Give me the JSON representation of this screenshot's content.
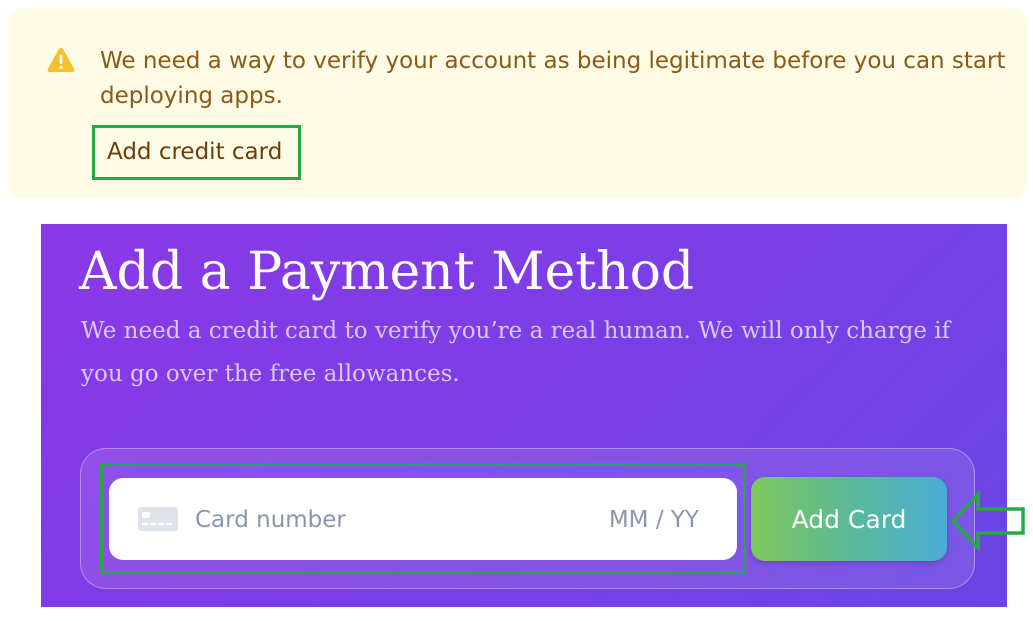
{
  "banner": {
    "icon": "warning-triangle-icon",
    "message": "We need a way to verify your account as being legitimate before you can start deploying apps.",
    "link_label": "Add credit card"
  },
  "payment": {
    "title": "Add a Payment Method",
    "description": "We need a credit card to verify you’re a real human. We will only charge if you go over the free allowances.",
    "card_icon": "credit-card-icon",
    "card_placeholder": "Card number",
    "expiry_placeholder": "MM / YY",
    "button_label": "Add Card"
  },
  "annotations": {
    "highlight_color": "#27a846",
    "arrow_icon": "left-arrow-outline-icon"
  },
  "colors": {
    "banner_bg": "#fefbe6",
    "banner_text": "#8a5a16",
    "panel_bg": "#7b3ee6",
    "button_gradient_start": "#7ec85a",
    "button_gradient_end": "#4aaed6"
  }
}
